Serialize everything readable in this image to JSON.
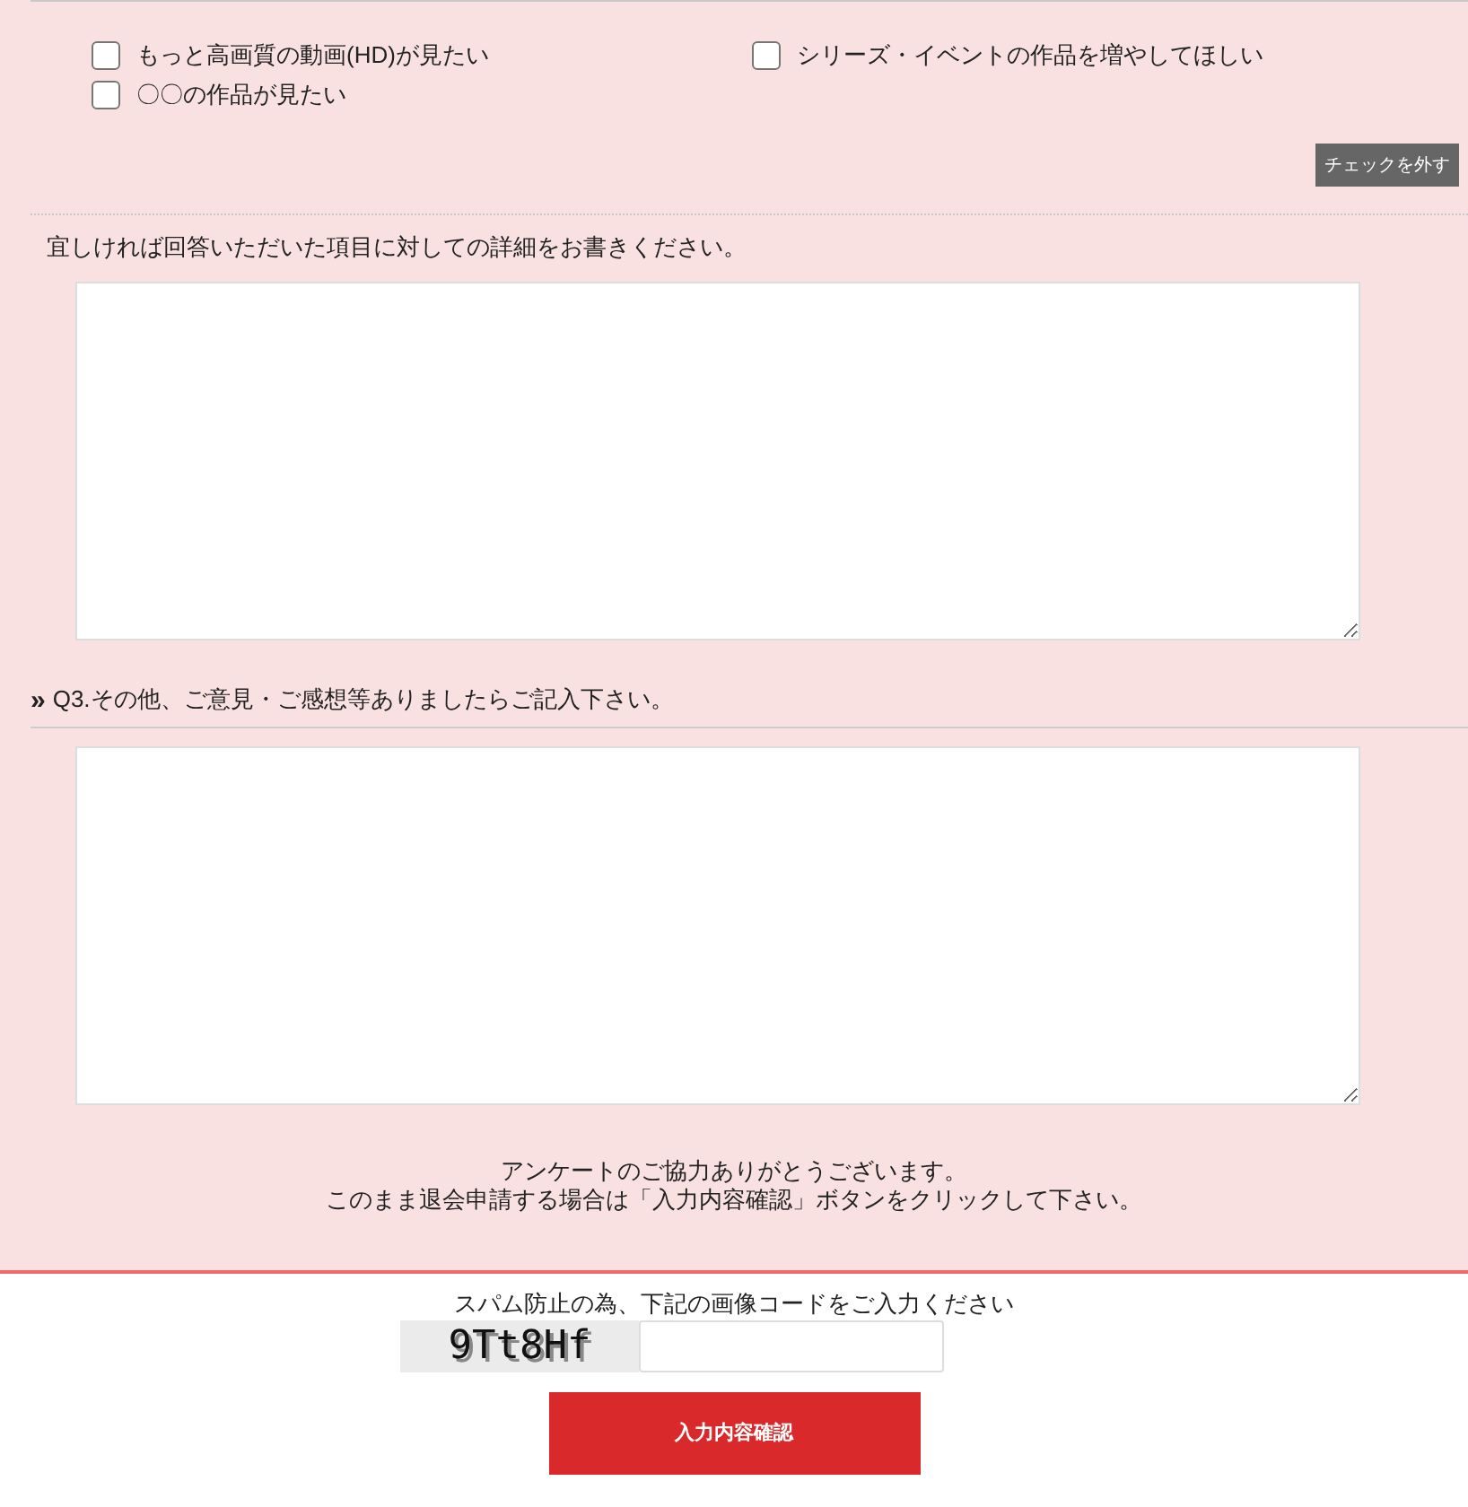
{
  "options": [
    {
      "label": "もっと高画質の動画(HD)が見たい",
      "checked": false
    },
    {
      "label": "シリーズ・イベントの作品を増やしてほしい",
      "checked": false
    },
    {
      "label": "〇〇の作品が見たい",
      "checked": false
    }
  ],
  "uncheck_button": "チェックを外す",
  "detail_prompt": "宜しければ回答いただいた項目に対しての詳細をお書きください。",
  "q3": {
    "marker": "»",
    "label": "Q3.その他、ご意見・ご感想等ありましたらご記入下さい。"
  },
  "thanks": [
    "アンケートのご協力ありがとうございます。",
    "このまま退会申請する場合は「入力内容確認」ボタンをクリックして下さい。"
  ],
  "captcha": {
    "prompt": "スパム防止の為、下記の画像コードをご入力ください",
    "code": "9Tt8Hf"
  },
  "submit_button": "入力内容確認"
}
